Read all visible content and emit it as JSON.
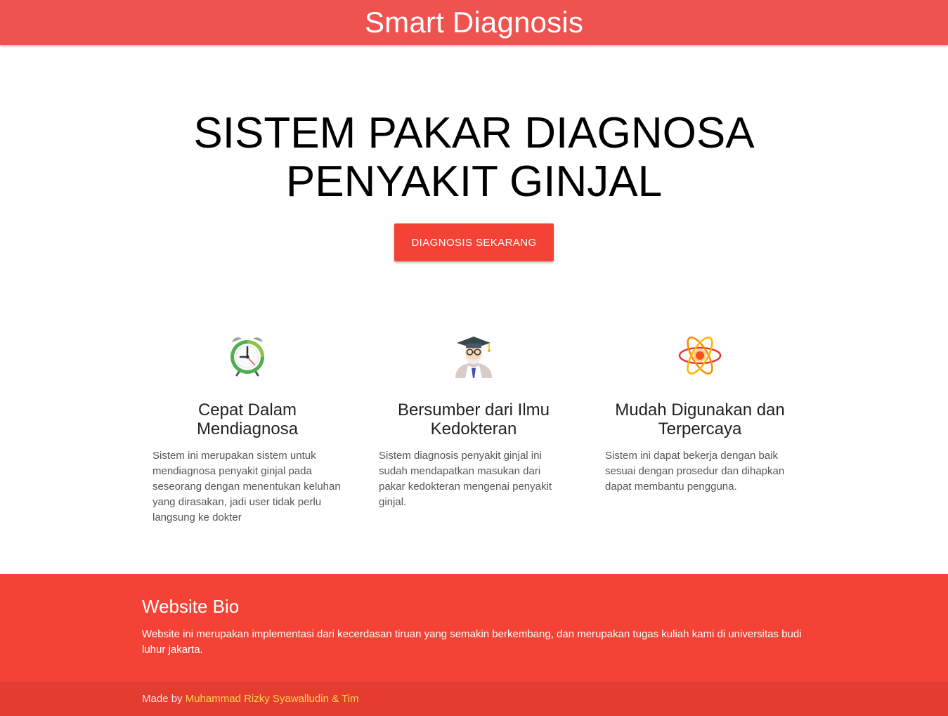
{
  "navbar": {
    "brand": "Smart Diagnosis",
    "color": "#ef5350"
  },
  "hero": {
    "title_line1": "SISTEM PAKAR DIAGNOSA",
    "title_line2": "PENYAKIT GINJAL",
    "cta_label": "DIAGNOSIS SEKARANG",
    "cta_color": "#f44336"
  },
  "features": [
    {
      "icon": "alarm-clock-icon",
      "title": "Cepat Dalam Mendiagnosa",
      "text": "Sistem ini merupakan sistem untuk mendiagnosa penyakit ginjal pada seseorang dengan menentukan keluhan yang dirasakan, jadi user tidak perlu langsung ke dokter"
    },
    {
      "icon": "professor-icon",
      "title": "Bersumber dari Ilmu Kedokteran",
      "text": "Sistem diagnosis penyakit ginjal ini sudah mendapatkan masukan dari pakar kedokteran mengenai penyakit ginjal."
    },
    {
      "icon": "atom-icon",
      "title": "Mudah Digunakan dan Terpercaya",
      "text": "Sistem ini dapat bekerja dengan baik sesuai dengan prosedur dan dihapkan dapat membantu pengguna."
    }
  ],
  "footer": {
    "title": "Website Bio",
    "text": "Website ini merupakan implementasi dari kecerdasan tiruan yang semakin berkembang, dan merupakan tugas kuliah kami di universitas budi luhur jakarta.",
    "made_by_prefix": "Made by ",
    "author_link": "Muhammad Rizky Syawalludin & Tim",
    "background": "#f44336",
    "copyright_background": "#e53c30",
    "link_color": "#ffd54f"
  }
}
